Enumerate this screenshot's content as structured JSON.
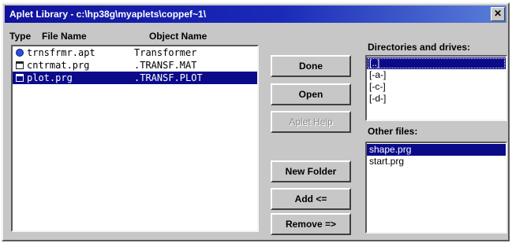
{
  "window": {
    "title": "Aplet Library - c:\\hp38g\\myaplets\\coppef~1\\"
  },
  "headers": {
    "type": "Type",
    "file_name": "File Name",
    "object_name": "Object Name"
  },
  "files": [
    {
      "icon": "aplet-icon",
      "file_name": "trnsfrmr.apt",
      "object_name": "Transformer",
      "selected": false
    },
    {
      "icon": "program-icon",
      "file_name": "cntrmat.prg",
      "object_name": ".TRANSF.MAT",
      "selected": false
    },
    {
      "icon": "program-icon",
      "file_name": "plot.prg",
      "object_name": ".TRANSF.PLOT",
      "selected": true
    }
  ],
  "buttons": {
    "done": "Done",
    "open": "Open",
    "aplet_help": "Aplet Help",
    "new_folder": "New Folder",
    "add": "Add <=",
    "remove": "Remove =>"
  },
  "directories": {
    "label": "Directories and drives:",
    "items": [
      "[..]",
      "[-a-]",
      "[-c-]",
      "[-d-]"
    ],
    "selected_index": 0
  },
  "other_files": {
    "label": "Other files:",
    "items": [
      "shape.prg",
      "start.prg"
    ],
    "selected_index": 0
  },
  "colors": {
    "title_bar": "#10129c",
    "selection": "#0b0b8a",
    "face": "#c7c7c7"
  }
}
